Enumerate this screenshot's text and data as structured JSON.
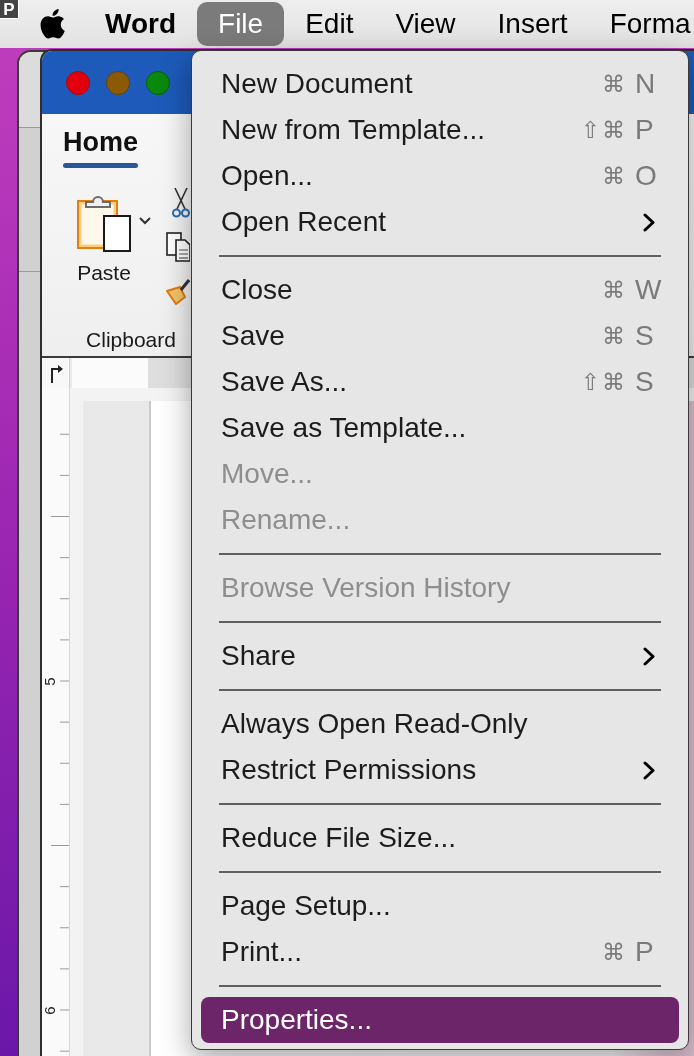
{
  "menu_bar": {
    "badge": "P",
    "menus": [
      {
        "kind": "app",
        "label": "Word",
        "selected": false
      },
      {
        "kind": "menu",
        "label": "File",
        "selected": true
      },
      {
        "kind": "menu",
        "label": "Edit",
        "selected": false
      },
      {
        "kind": "menu",
        "label": "View",
        "selected": false
      },
      {
        "kind": "menu",
        "label": "Insert",
        "selected": false
      },
      {
        "kind": "menu",
        "label": "Forma",
        "selected": false
      }
    ]
  },
  "window": {
    "ribbon": {
      "tabs": [
        {
          "label": "Home",
          "selected": true
        }
      ],
      "groups": [
        {
          "label": "Clipboard",
          "paste_label": "Paste"
        }
      ]
    },
    "vertical_ruler": {
      "numbers": [
        "5",
        "6"
      ]
    }
  },
  "file_menu": {
    "sections": [
      {
        "items": [
          {
            "label": "New Document",
            "modifiers": "⌘",
            "key": "N",
            "disabled": false,
            "highlighted": false,
            "submenu": false
          },
          {
            "label": "New from Template...",
            "modifiers": "⇧⌘",
            "key": "P",
            "disabled": false,
            "highlighted": false,
            "submenu": false
          },
          {
            "label": "Open...",
            "modifiers": "⌘",
            "key": "O",
            "disabled": false,
            "highlighted": false,
            "submenu": false
          },
          {
            "label": "Open Recent",
            "disabled": false,
            "highlighted": false,
            "submenu": true
          }
        ]
      },
      {
        "items": [
          {
            "label": "Close",
            "modifiers": "⌘",
            "key": "W",
            "disabled": false,
            "highlighted": false,
            "submenu": false
          },
          {
            "label": "Save",
            "modifiers": "⌘",
            "key": "S",
            "disabled": false,
            "highlighted": false,
            "submenu": false
          },
          {
            "label": "Save As...",
            "modifiers": "⇧⌘",
            "key": "S",
            "disabled": false,
            "highlighted": false,
            "submenu": false
          },
          {
            "label": "Save as Template...",
            "disabled": false,
            "highlighted": false,
            "submenu": false
          },
          {
            "label": "Move...",
            "disabled": true,
            "highlighted": false,
            "submenu": false
          },
          {
            "label": "Rename...",
            "disabled": true,
            "highlighted": false,
            "submenu": false
          }
        ]
      },
      {
        "items": [
          {
            "label": "Browse Version History",
            "disabled": true,
            "highlighted": false,
            "submenu": false
          }
        ]
      },
      {
        "items": [
          {
            "label": "Share",
            "disabled": false,
            "highlighted": false,
            "submenu": true
          }
        ]
      },
      {
        "items": [
          {
            "label": "Always Open Read-Only",
            "disabled": false,
            "highlighted": false,
            "submenu": false
          },
          {
            "label": "Restrict Permissions",
            "disabled": false,
            "highlighted": false,
            "submenu": true
          }
        ]
      },
      {
        "items": [
          {
            "label": "Reduce File Size...",
            "disabled": false,
            "highlighted": false,
            "submenu": false
          }
        ]
      },
      {
        "items": [
          {
            "label": "Page Setup...",
            "disabled": false,
            "highlighted": false,
            "submenu": false
          },
          {
            "label": "Print...",
            "modifiers": "⌘",
            "key": "P",
            "disabled": false,
            "highlighted": false,
            "submenu": false
          }
        ]
      },
      {
        "items": [
          {
            "label": "Properties...",
            "disabled": false,
            "highlighted": true,
            "submenu": false
          }
        ]
      }
    ]
  }
}
